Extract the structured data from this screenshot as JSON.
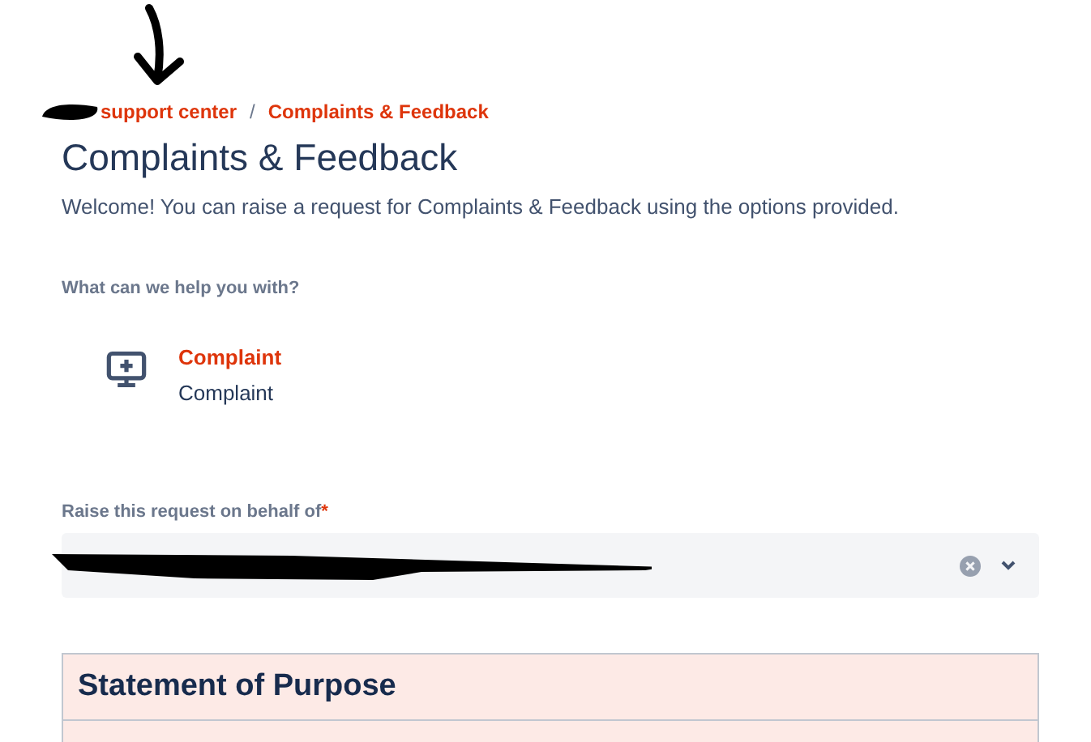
{
  "breadcrumbs": [
    {
      "label": "support center"
    },
    {
      "label": "Complaints & Feedback"
    }
  ],
  "breadcrumb_separator": "/",
  "title": "Complaints & Feedback",
  "welcome": "Welcome! You can raise a request for Complaints & Feedback using the options provided.",
  "help_label": "What can we help you with?",
  "request_types": [
    {
      "name": "Complaint",
      "description": "Complaint"
    }
  ],
  "on_behalf": {
    "label": "Raise this request on behalf of",
    "required_mark": "*"
  },
  "section": {
    "title": "Statement of Purpose"
  }
}
